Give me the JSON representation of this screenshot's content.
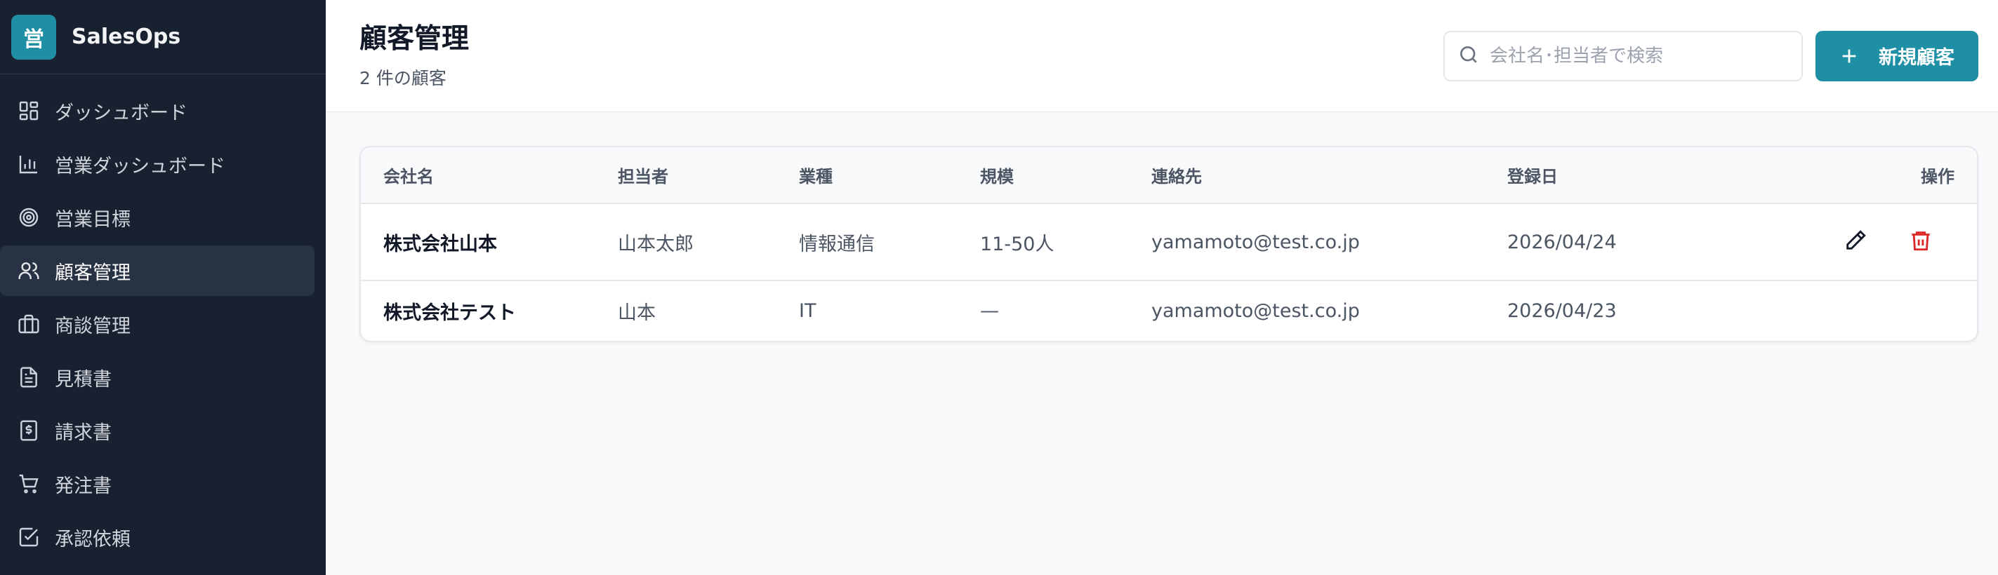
{
  "brand": {
    "logo_char": "営",
    "name": "SalesOps",
    "color": "#1f8fa6"
  },
  "sidebar": {
    "items": [
      {
        "label": "ダッシュボード",
        "icon": "dashboard-icon"
      },
      {
        "label": "営業ダッシュボード",
        "icon": "bar-chart-icon"
      },
      {
        "label": "営業目標",
        "icon": "target-icon"
      },
      {
        "label": "顧客管理",
        "icon": "users-icon",
        "active": true
      },
      {
        "label": "商談管理",
        "icon": "briefcase-icon"
      },
      {
        "label": "見積書",
        "icon": "document-icon"
      },
      {
        "label": "請求書",
        "icon": "invoice-icon"
      },
      {
        "label": "発注書",
        "icon": "cart-icon"
      },
      {
        "label": "承認依頼",
        "icon": "check-square-icon"
      }
    ]
  },
  "header": {
    "title": "顧客管理",
    "subtitle": "2 件の顧客",
    "search_placeholder": "会社名･担当者で検索",
    "add_label": "新規顧客"
  },
  "table": {
    "columns": [
      "会社名",
      "担当者",
      "業種",
      "規模",
      "連絡先",
      "登録日",
      "操作"
    ],
    "rows": [
      {
        "company": "株式会社山本",
        "person": "山本太郎",
        "industry": "情報通信",
        "size": "11-50人",
        "contact": "yamamoto@test.co.jp",
        "date": "2026/04/24",
        "has_actions": true
      },
      {
        "company": "株式会社テスト",
        "person": "山本",
        "industry": "IT",
        "size": "—",
        "contact": "yamamoto@test.co.jp",
        "date": "2026/04/23",
        "has_actions": false
      }
    ]
  },
  "colors": {
    "accent": "#1f8fa6",
    "sidebar_bg": "#18212f",
    "delete": "#dc2626"
  }
}
